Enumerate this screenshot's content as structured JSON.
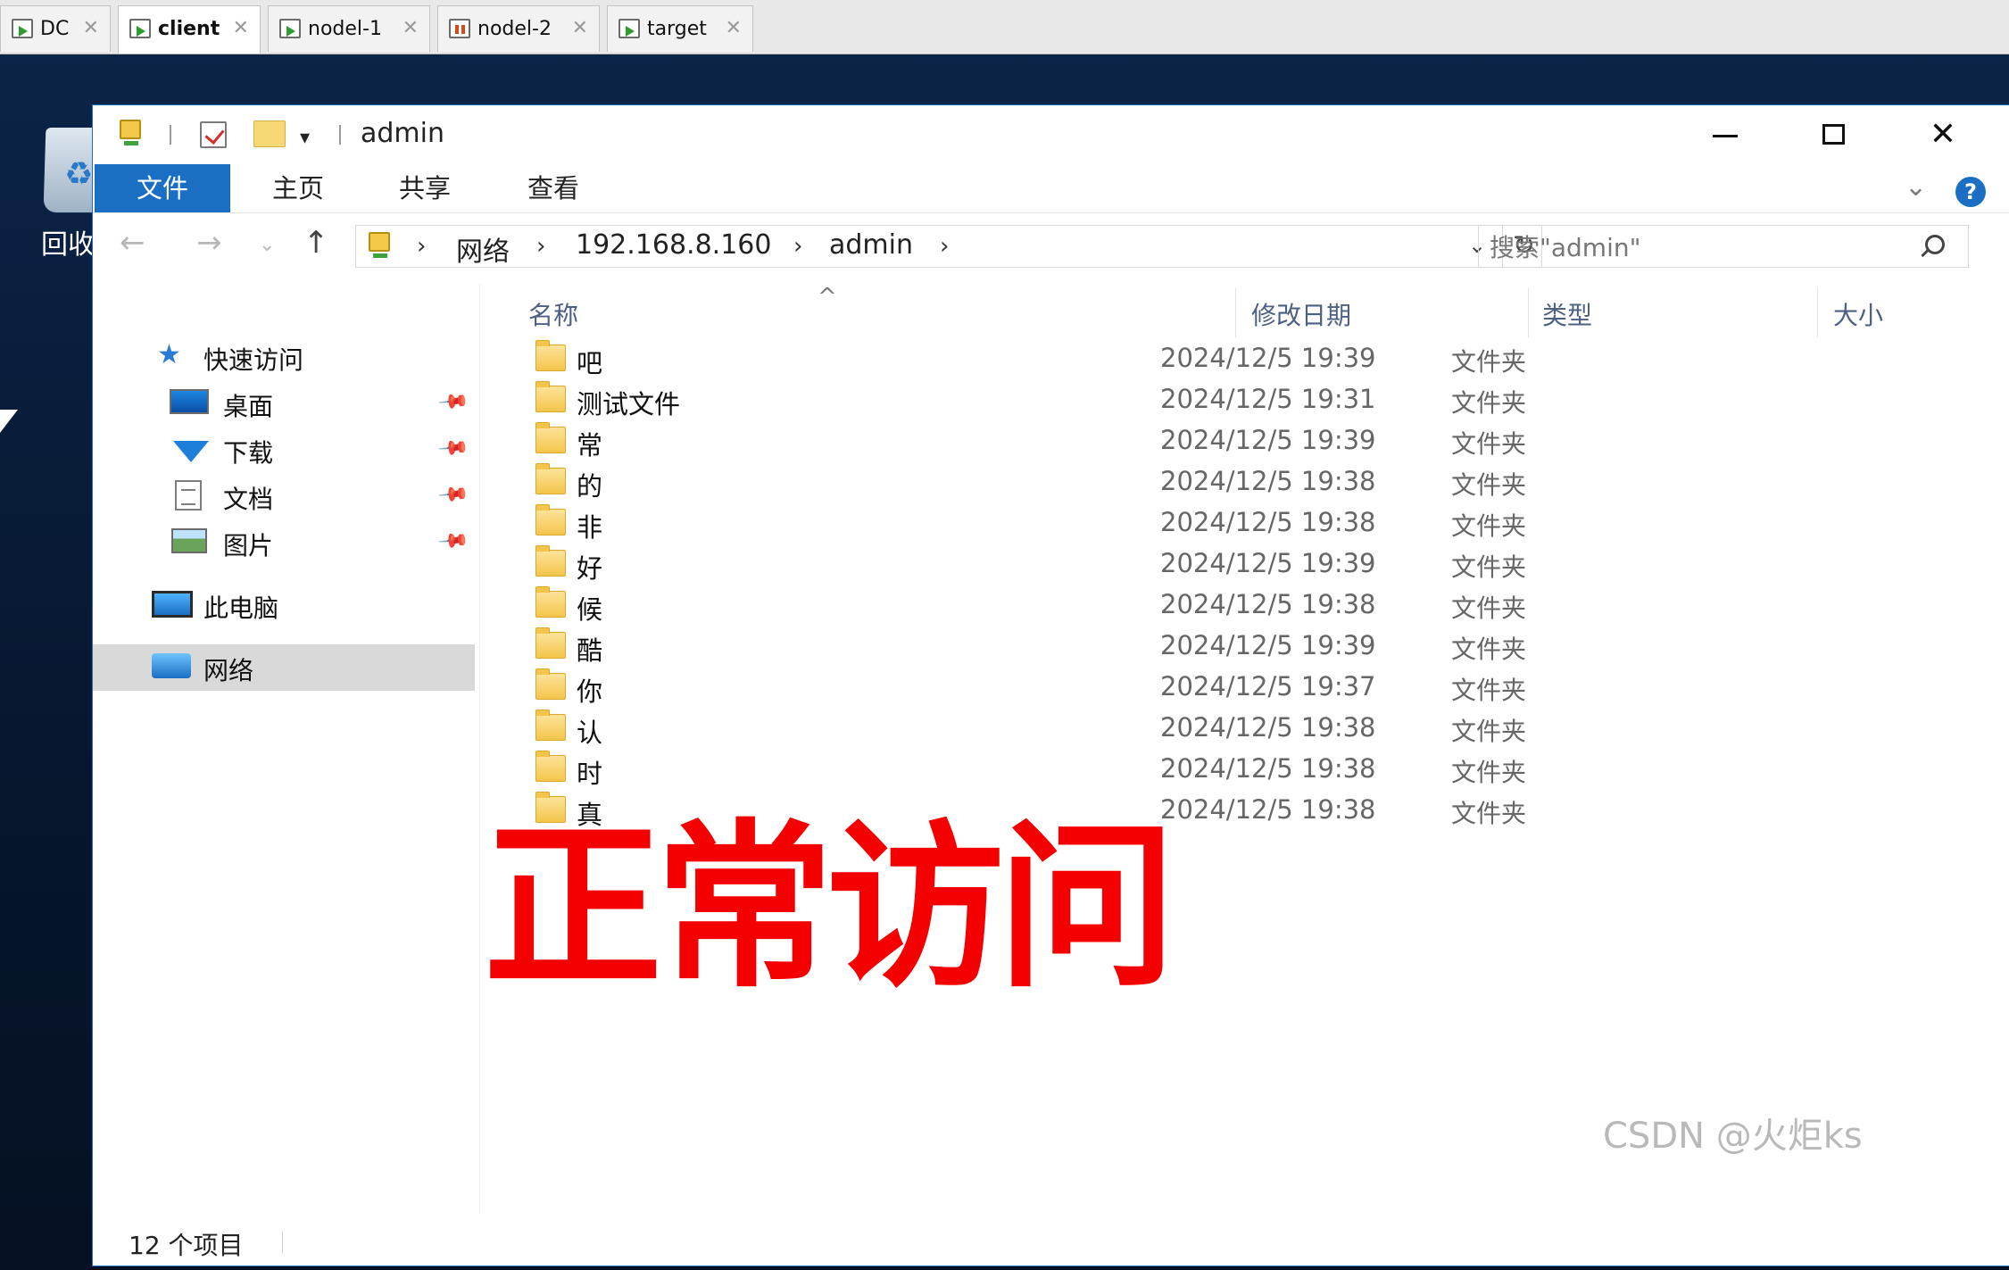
{
  "vm_tabs": [
    {
      "label": "DC",
      "state": "running"
    },
    {
      "label": "client",
      "state": "running",
      "active": true
    },
    {
      "label": "nodel-1",
      "state": "running"
    },
    {
      "label": "nodel-2",
      "state": "paused"
    },
    {
      "label": "target",
      "state": "running"
    }
  ],
  "desktop": {
    "recycle_bin_label": "回收"
  },
  "window": {
    "title": "admin",
    "minimize_glyph": "—",
    "close_glyph": "✕"
  },
  "ribbon": {
    "tabs": [
      "文件",
      "主页",
      "共享",
      "查看"
    ],
    "help": "?"
  },
  "address": {
    "crumbs": [
      "网络",
      "192.168.8.160",
      "admin"
    ],
    "search_placeholder": "搜索\"admin\""
  },
  "nav_pane": {
    "quick_access": "快速访问",
    "items": [
      "桌面",
      "下载",
      "文档",
      "图片"
    ],
    "this_pc": "此电脑",
    "network": "网络"
  },
  "columns": [
    "名称",
    "修改日期",
    "类型",
    "大小"
  ],
  "files": [
    {
      "name": "吧",
      "date": "2024/12/5 19:39",
      "type": "文件夹"
    },
    {
      "name": "测试文件",
      "date": "2024/12/5 19:31",
      "type": "文件夹"
    },
    {
      "name": "常",
      "date": "2024/12/5 19:39",
      "type": "文件夹"
    },
    {
      "name": "的",
      "date": "2024/12/5 19:38",
      "type": "文件夹"
    },
    {
      "name": "非",
      "date": "2024/12/5 19:38",
      "type": "文件夹"
    },
    {
      "name": "好",
      "date": "2024/12/5 19:39",
      "type": "文件夹"
    },
    {
      "name": "候",
      "date": "2024/12/5 19:38",
      "type": "文件夹"
    },
    {
      "name": "酷",
      "date": "2024/12/5 19:39",
      "type": "文件夹"
    },
    {
      "name": "你",
      "date": "2024/12/5 19:37",
      "type": "文件夹"
    },
    {
      "name": "认",
      "date": "2024/12/5 19:38",
      "type": "文件夹"
    },
    {
      "name": "时",
      "date": "2024/12/5 19:38",
      "type": "文件夹"
    },
    {
      "name": "真",
      "date": "2024/12/5 19:38",
      "type": "文件夹"
    }
  ],
  "overlay_text": "正常访问",
  "status": {
    "item_count": "12 个项目"
  },
  "watermark": "CSDN @火炬ks",
  "colors": {
    "accent": "#1a6fc4",
    "overlay": "#f50000",
    "desktop": "#0b2447"
  }
}
